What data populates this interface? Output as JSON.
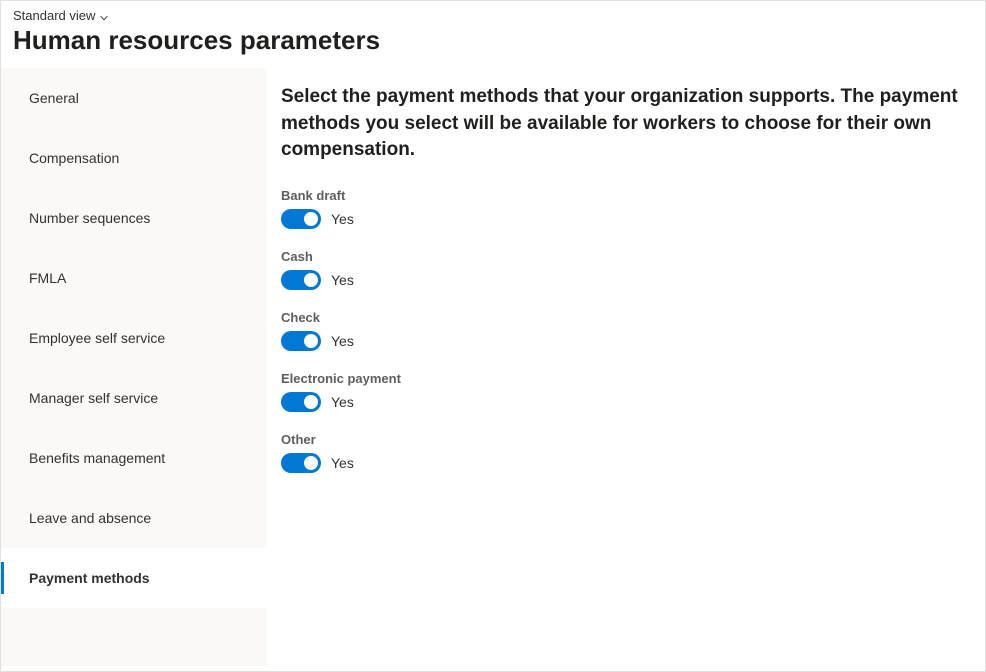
{
  "header": {
    "view_label": "Standard view",
    "page_title": "Human resources parameters"
  },
  "sidebar": {
    "items": [
      {
        "label": "General",
        "active": false
      },
      {
        "label": "Compensation",
        "active": false
      },
      {
        "label": "Number sequences",
        "active": false
      },
      {
        "label": "FMLA",
        "active": false
      },
      {
        "label": "Employee self service",
        "active": false
      },
      {
        "label": "Manager self service",
        "active": false
      },
      {
        "label": "Benefits management",
        "active": false
      },
      {
        "label": "Leave and absence",
        "active": false
      },
      {
        "label": "Payment methods",
        "active": true
      }
    ]
  },
  "main": {
    "instructions": "Select the payment methods that your organization supports. The payment methods you select will be available for workers to choose for their own compensation.",
    "toggles": [
      {
        "label": "Bank draft",
        "value": "Yes",
        "on": true
      },
      {
        "label": "Cash",
        "value": "Yes",
        "on": true
      },
      {
        "label": "Check",
        "value": "Yes",
        "on": true
      },
      {
        "label": "Electronic payment",
        "value": "Yes",
        "on": true
      },
      {
        "label": "Other",
        "value": "Yes",
        "on": true
      }
    ]
  },
  "colors": {
    "primary": "#0078d4"
  }
}
